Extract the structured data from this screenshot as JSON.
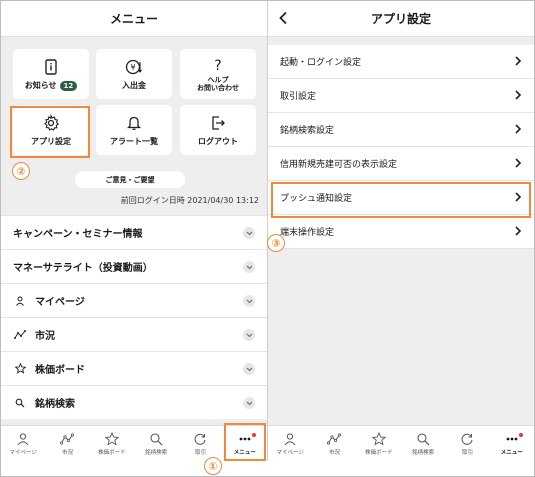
{
  "left": {
    "title": "メニュー",
    "tiles": [
      {
        "label": "お知らせ",
        "badge": "12",
        "icon": "notice-icon"
      },
      {
        "label": "入出金",
        "icon": "deposit-withdraw-icon"
      },
      {
        "label_line1": "ヘルプ",
        "label_line2": "お問い合わせ",
        "icon": "help-icon"
      },
      {
        "label": "アプリ設定",
        "icon": "gear-icon"
      },
      {
        "label": "アラート一覧",
        "icon": "bell-icon"
      },
      {
        "label": "ログアウト",
        "icon": "logout-icon"
      }
    ],
    "feedback_label": "ご意見・ご要望",
    "last_login": "前回ログイン日時 2021/04/30 13:12",
    "menu_items": [
      {
        "label": "キャンペーン・セミナー情報"
      },
      {
        "label": "マネーサテライト（投資動画）"
      },
      {
        "label": "マイページ",
        "icon": "person-icon"
      },
      {
        "label": "市況",
        "icon": "market-icon"
      },
      {
        "label": "株価ボード",
        "icon": "star-icon"
      },
      {
        "label": "銘柄検索",
        "icon": "search-icon"
      }
    ]
  },
  "right": {
    "title": "アプリ設定",
    "settings": [
      {
        "label": "起動・ログイン設定"
      },
      {
        "label": "取引設定"
      },
      {
        "label": "銘柄検索設定"
      },
      {
        "label": "信用新規売建可否の表示設定"
      },
      {
        "label": "プッシュ通知設定"
      },
      {
        "label": "端末操作設定"
      }
    ]
  },
  "tabbar": [
    {
      "label": "マイページ",
      "icon": "person-icon"
    },
    {
      "label": "市況",
      "icon": "market-icon"
    },
    {
      "label": "株価ボード",
      "icon": "star-icon"
    },
    {
      "label": "銘柄検索",
      "icon": "search-icon"
    },
    {
      "label": "取引",
      "icon": "trade-icon"
    },
    {
      "label": "メニュー",
      "icon": "more-icon",
      "active": true
    }
  ],
  "callouts": [
    "①",
    "②",
    "③"
  ],
  "colors": {
    "accent": "#f08a3a",
    "brand": "#2c5f41",
    "notification_dot": "#e53935"
  }
}
